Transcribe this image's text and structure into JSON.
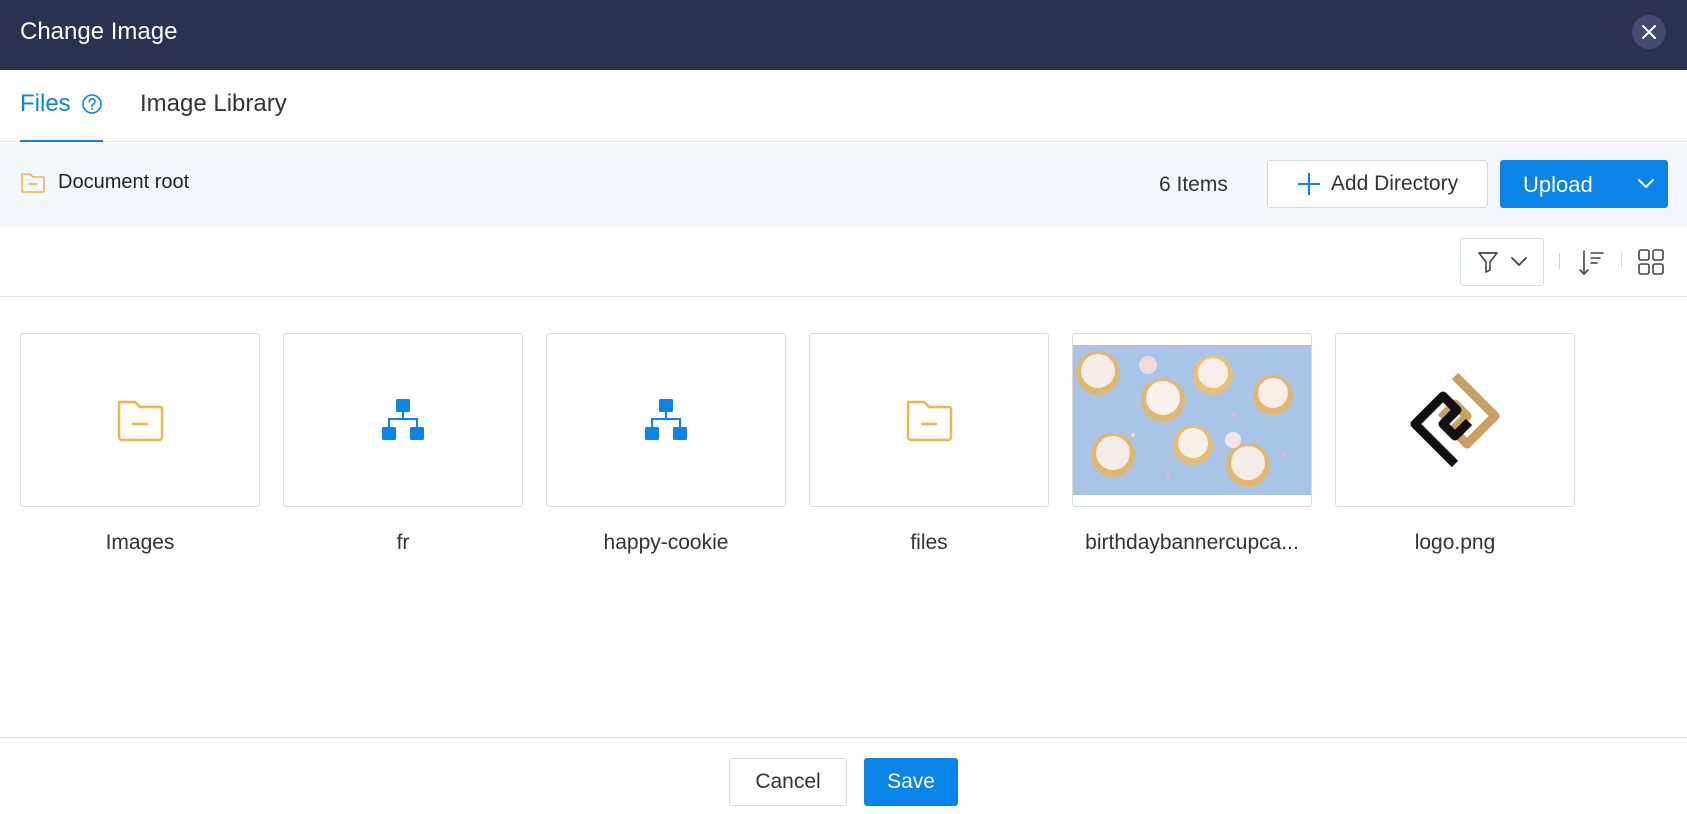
{
  "dialog": {
    "title": "Change Image",
    "close_icon": "close-icon"
  },
  "tabs": [
    {
      "label": "Files",
      "active": true,
      "icon": "help-circle-icon"
    },
    {
      "label": "Image Library",
      "active": false
    }
  ],
  "toolbar": {
    "breadcrumb": "Document root",
    "item_count": "6 Items",
    "add_directory_label": "Add Directory",
    "upload_label": "Upload"
  },
  "items": [
    {
      "name": "Images",
      "type": "folder",
      "icon": "folder-icon"
    },
    {
      "name": "fr",
      "type": "sitemap",
      "icon": "sitemap-icon"
    },
    {
      "name": "happy-cookie",
      "type": "sitemap",
      "icon": "sitemap-icon"
    },
    {
      "name": "files",
      "type": "folder",
      "icon": "folder-icon"
    },
    {
      "name": "birthdaybannercupca...",
      "type": "image",
      "icon": "image-thumbnail"
    },
    {
      "name": "logo.png",
      "type": "image",
      "icon": "logo-thumbnail"
    }
  ],
  "footer": {
    "cancel_label": "Cancel",
    "save_label": "Save"
  },
  "colors": {
    "header_bg": "#2c3150",
    "accent": "#0a84e8",
    "folder": "#f5b342",
    "toolbar_bg": "#f4f8fc"
  }
}
